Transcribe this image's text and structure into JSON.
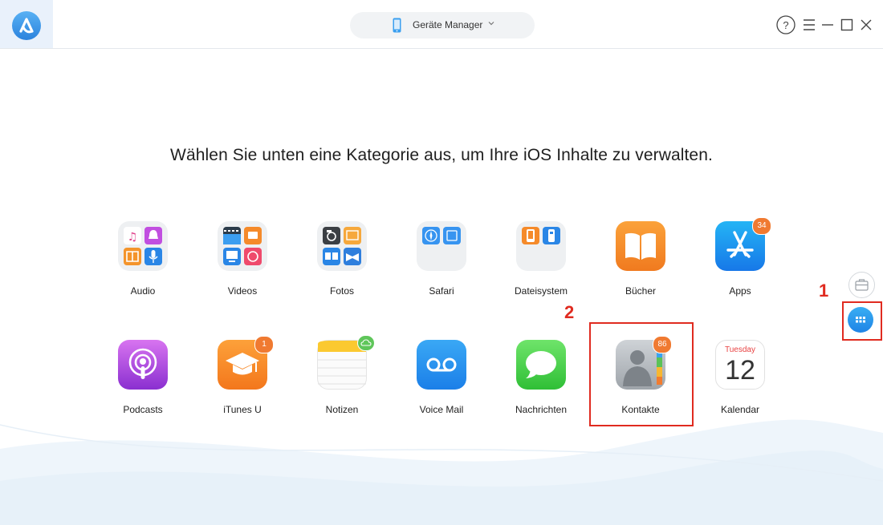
{
  "header": {
    "device_selector_label": "Geräte Manager"
  },
  "main": {
    "heading": "Wählen Sie unten eine Kategorie aus, um Ihre iOS Inhalte zu verwalten."
  },
  "categories_row1": [
    {
      "label": "Audio"
    },
    {
      "label": "Videos"
    },
    {
      "label": "Fotos"
    },
    {
      "label": "Safari"
    },
    {
      "label": "Dateisystem"
    },
    {
      "label": "Bücher"
    },
    {
      "label": "Apps",
      "badge": "34"
    }
  ],
  "categories_row2": [
    {
      "label": "Podcasts"
    },
    {
      "label": "iTunes U",
      "badge": "1"
    },
    {
      "label": "Notizen"
    },
    {
      "label": "Voice Mail"
    },
    {
      "label": "Nachrichten"
    },
    {
      "label": "Kontakte",
      "badge": "86"
    },
    {
      "label": "Kalendar",
      "calendar_month": "Tuesday",
      "calendar_day": "12"
    }
  ],
  "annotations": {
    "step1": "1",
    "step2": "2"
  },
  "colors": {
    "accent_blue": "#2f8ee8",
    "badge_orange": "#f07a31",
    "annotation_red": "#e02b20"
  }
}
